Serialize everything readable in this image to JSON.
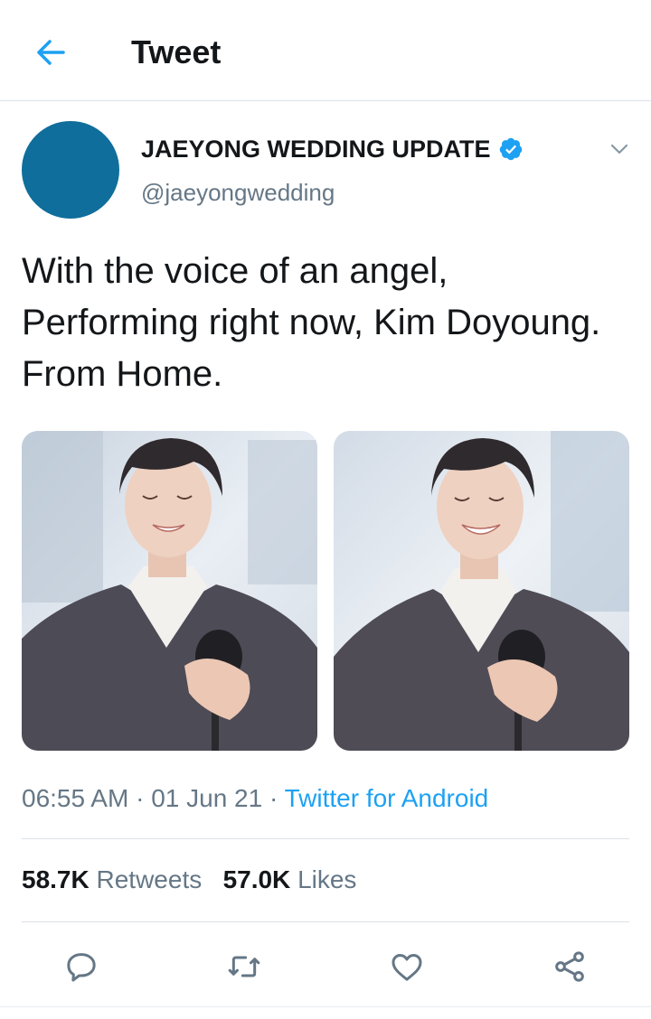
{
  "header": {
    "title": "Tweet",
    "back_icon": "arrow-left-icon"
  },
  "tweet": {
    "display_name": "JAEYONG WEDDING UPDATE",
    "handle": "@jaeyongwedding",
    "verified": true,
    "text": "With the voice of an angel,\n Performing right now, Kim Doyoung. From Home.",
    "photos": [
      {
        "name": "photo-1"
      },
      {
        "name": "photo-2"
      }
    ],
    "time": "06:55 AM",
    "date": "01 Jun 21",
    "separator": "·",
    "source": "Twitter for Android",
    "retweets_count": "58.7K",
    "retweets_label": "Retweets",
    "likes_count": "57.0K",
    "likes_label": "Likes"
  },
  "actions": [
    "reply-icon",
    "retweet-icon",
    "like-icon",
    "share-icon"
  ],
  "colors": {
    "accent": "#1da1f2",
    "avatar": "#0f6e9b",
    "text": "#14171a",
    "secondary": "#657786",
    "divider": "#dbe2e8"
  }
}
